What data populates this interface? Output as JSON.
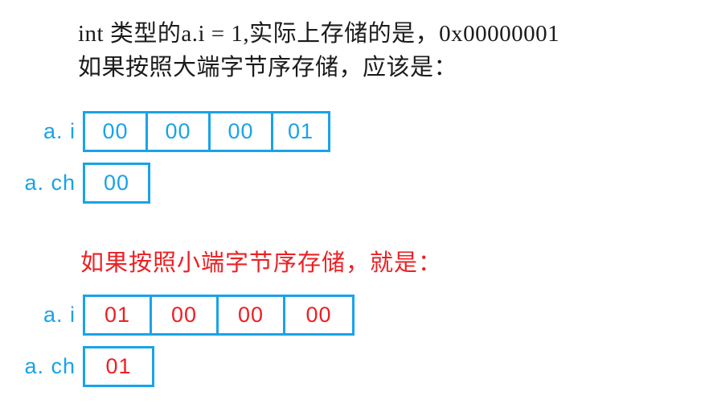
{
  "intro": {
    "line1": "int 类型的a.i = 1,实际上存储的是，0x00000001",
    "line2": "如果按照大端字节序存储，应该是："
  },
  "red_caption": "如果按照小端字节序存储，就是：",
  "colors": {
    "blue": "#19a3e8",
    "red": "#ec2024",
    "text": "#1b1b1b",
    "background": "#ffffff"
  },
  "diagrams": [
    {
      "name": "big-endian",
      "rows": [
        {
          "label": "a. i",
          "value_color": "blue",
          "cells": [
            "00",
            "00",
            "00",
            "01"
          ]
        },
        {
          "label": "a. ch",
          "value_color": "blue",
          "cells": [
            "00"
          ]
        }
      ]
    },
    {
      "name": "little-endian",
      "rows": [
        {
          "label": "a. i",
          "value_color": "red",
          "cells": [
            "01",
            "00",
            "00",
            "00"
          ]
        },
        {
          "label": "a. ch",
          "value_color": "red",
          "cells": [
            "01"
          ]
        }
      ]
    }
  ]
}
